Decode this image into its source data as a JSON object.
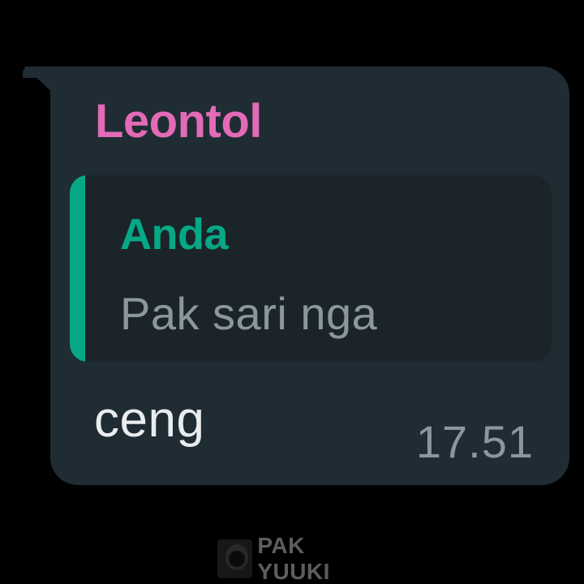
{
  "message": {
    "sender_name": "Leontol",
    "quoted": {
      "author": "Anda",
      "text": "Pak sari nga"
    },
    "text": "ceng",
    "time": "17.51"
  },
  "watermark": {
    "label": "PAK YUUKI",
    "icon": "avatar-logo-icon"
  },
  "colors": {
    "background": "#000000",
    "bubble": "#202c33",
    "quote_background": "#1b2529",
    "sender": "#e26ab6",
    "quote_accent": "#06a885",
    "message_text": "#e9edef",
    "secondary_text": "#8b979c"
  }
}
